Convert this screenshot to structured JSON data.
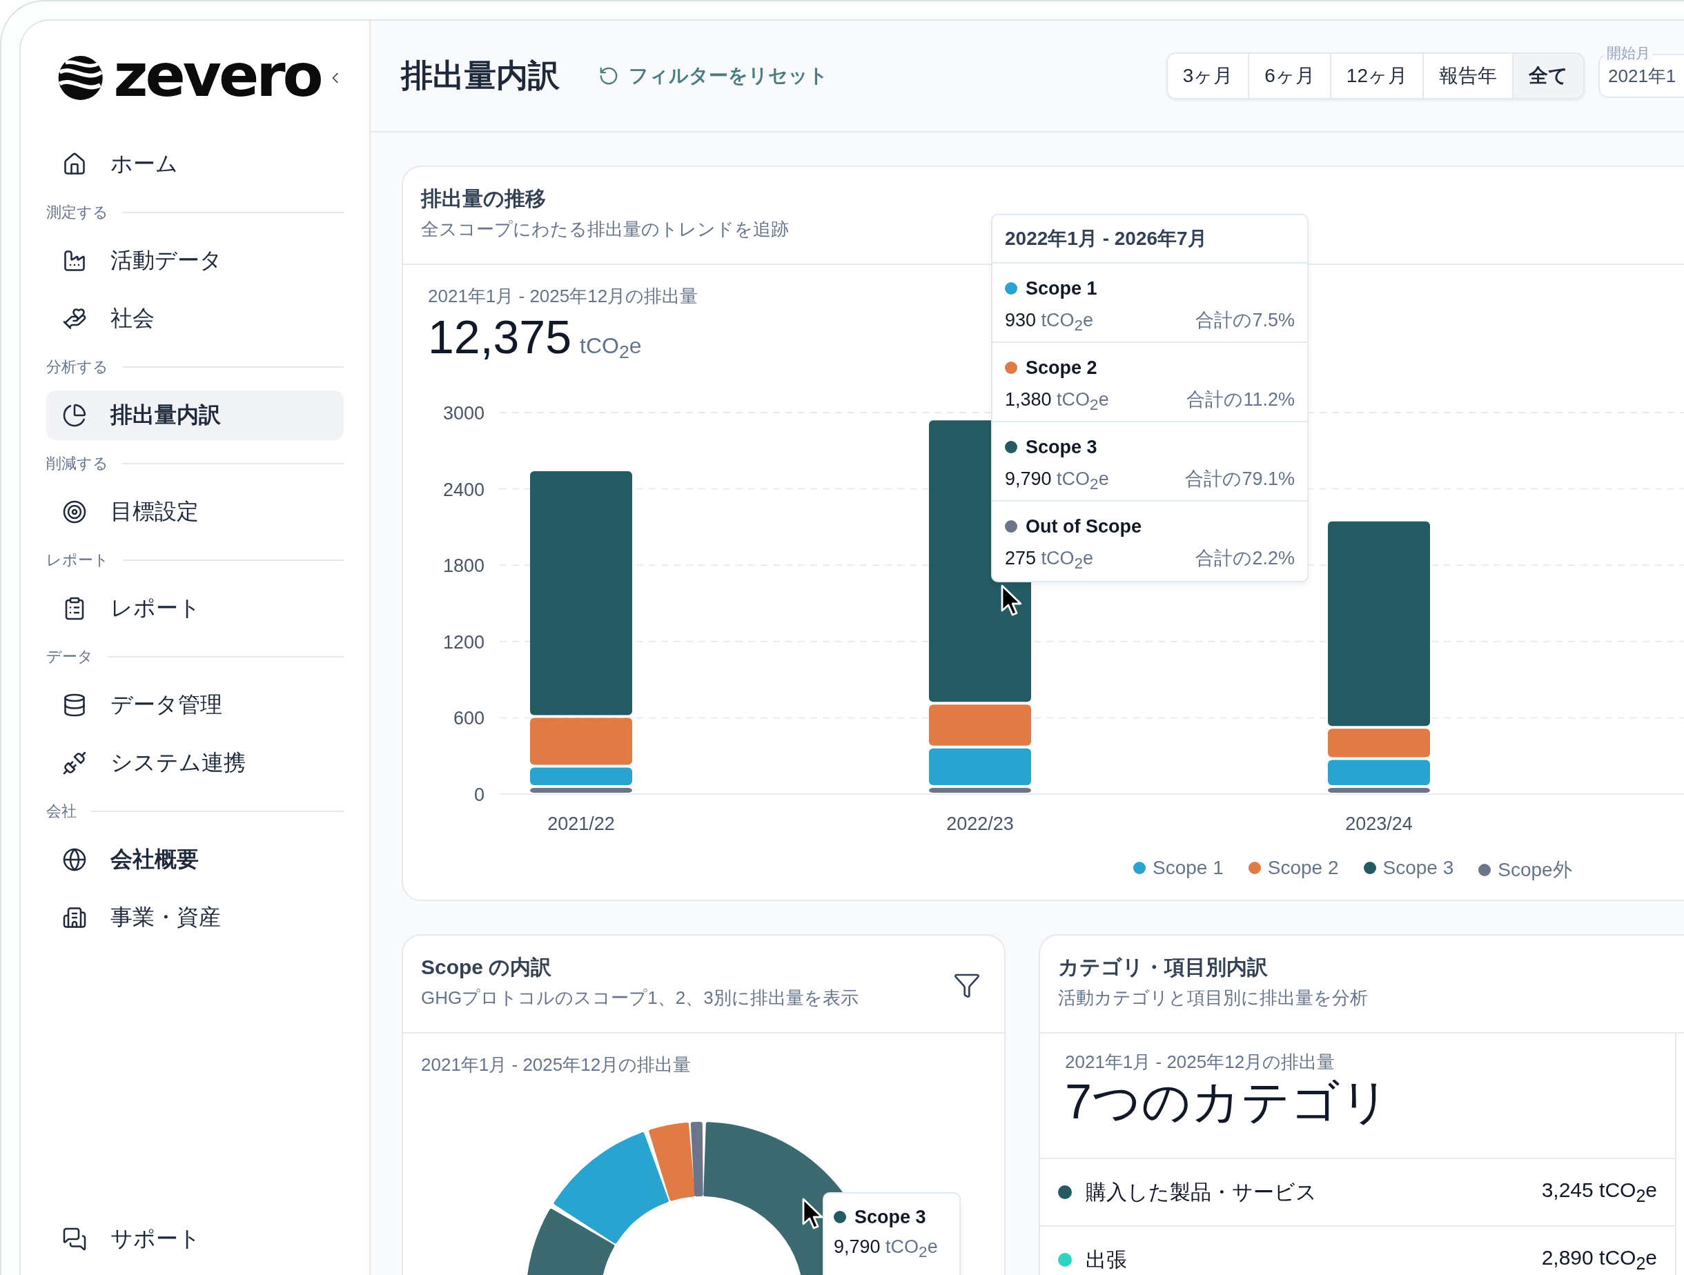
{
  "sidebar": {
    "logo": "zevero",
    "items": [
      {
        "kind": "item",
        "label": "ホーム",
        "selected": false,
        "bold": false
      },
      {
        "kind": "section",
        "label": "測定する"
      },
      {
        "kind": "item",
        "label": "活動データ",
        "selected": false,
        "bold": false
      },
      {
        "kind": "item",
        "label": "社会",
        "selected": false,
        "bold": false
      },
      {
        "kind": "section",
        "label": "分析する"
      },
      {
        "kind": "item",
        "label": "排出量内訳",
        "selected": true,
        "bold": true
      },
      {
        "kind": "section",
        "label": "削減する"
      },
      {
        "kind": "item",
        "label": "目標設定",
        "selected": false,
        "bold": false
      },
      {
        "kind": "section",
        "label": "レポート"
      },
      {
        "kind": "item",
        "label": "レポート",
        "selected": false,
        "bold": false
      },
      {
        "kind": "section",
        "label": "データ"
      },
      {
        "kind": "item",
        "label": "データ管理",
        "selected": false,
        "bold": false
      },
      {
        "kind": "item",
        "label": "システム連携",
        "selected": false,
        "bold": false
      },
      {
        "kind": "section",
        "label": "会社"
      },
      {
        "kind": "item",
        "label": "会社概要",
        "selected": false,
        "bold": true
      },
      {
        "kind": "item",
        "label": "事業・資産",
        "selected": false,
        "bold": false
      }
    ],
    "footer": [
      {
        "label": "サポート"
      }
    ]
  },
  "header": {
    "title": "排出量内訳",
    "reset": "フィルターをリセット",
    "ranges": [
      {
        "label": "3ヶ月",
        "selected": false
      },
      {
        "label": "6ヶ月",
        "selected": false
      },
      {
        "label": "12ヶ月",
        "selected": false
      },
      {
        "label": "報告年",
        "selected": false
      },
      {
        "label": "全て",
        "selected": true
      }
    ],
    "start_field": {
      "label": "開始月",
      "value": "2021年1"
    }
  },
  "trend_card": {
    "title": "排出量の推移",
    "subtitle": "全スコープにわたる排出量のトレンドを追跡",
    "period": "2021年1月 - 2025年12月の排出量",
    "total": "12,375",
    "unit": "tCO$_{2}$e",
    "chart_data": {
      "type": "bar",
      "stacked": true,
      "grid": true,
      "categories": [
        "2021/22",
        "2022/23",
        "2023/24"
      ],
      "ylim": [
        0,
        3000
      ],
      "yticks": [
        0,
        600,
        1200,
        1800,
        2400,
        3000
      ],
      "series": [
        {
          "name": "Scope 1",
          "color": "#29a3cf",
          "values": [
            160,
            310,
            220
          ]
        },
        {
          "name": "Scope 2",
          "color": "#e07b45",
          "values": [
            390,
            345,
            245
          ]
        },
        {
          "name": "Scope 3",
          "color": "#245a62",
          "values": [
            1940,
            2235,
            1630
          ]
        },
        {
          "name": "Scope外",
          "color": "#6b7489",
          "values": [
            60,
            60,
            60
          ]
        }
      ]
    },
    "tooltip": {
      "title": "2022年1月 - 2026年7月",
      "rows": [
        {
          "name": "Scope 1",
          "color": "#29a3cf",
          "value": "930",
          "unit": "tCO$_{2}$e",
          "share": "合計の7.5%"
        },
        {
          "name": "Scope 2",
          "color": "#e07b45",
          "value": "1,380",
          "unit": "tCO$_{2}$e",
          "share": "合計の11.2%"
        },
        {
          "name": "Scope 3",
          "color": "#245a62",
          "value": "9,790",
          "unit": "tCO$_{2}$e",
          "share": "合計の79.1%"
        },
        {
          "name": "Out of Scope",
          "color": "#6b7489",
          "value": "275",
          "unit": "tCO$_{2}$e",
          "share": "合計の2.2%"
        }
      ]
    }
  },
  "scope_card": {
    "title": "Scope の内訳",
    "subtitle": "GHGプロトコルのスコープ1、2、3別に排出量を表示",
    "period": "2021年1月 - 2025年12月の排出量",
    "tooltip": {
      "name": "Scope 3",
      "color": "#245a62",
      "value": "9,790",
      "unit": "tCO$_{2}$e"
    }
  },
  "category_card": {
    "title": "カテゴリ・項目別内訳",
    "subtitle": "活動カテゴリと項目別に排出量を分析",
    "period": "2021年1月 - 2025年12月の排出量",
    "headline": "7つのカテゴリ",
    "rows": [
      {
        "label": "購入した製品・サービス",
        "color": "#245a62",
        "value": "3,245 tCO$_{2}$e"
      },
      {
        "label": "出張",
        "color": "#2dd4bf",
        "value": "2,890 tCO$_{2}$e"
      }
    ]
  }
}
